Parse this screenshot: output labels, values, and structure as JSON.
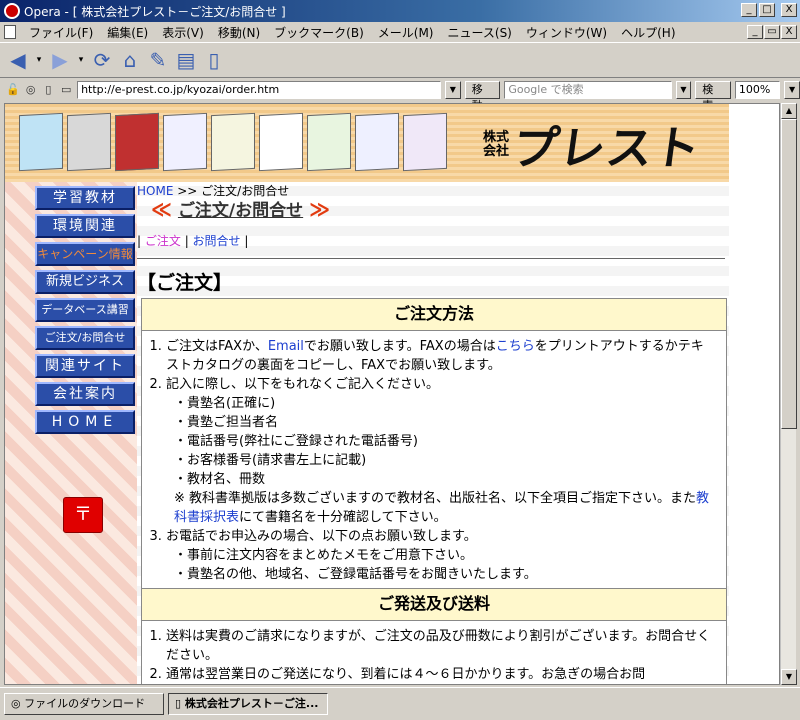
{
  "window": {
    "title": "Opera - [ 株式会社プレスト－ご注文/お問合せ ]",
    "buttons": {
      "min": "_",
      "max": "□",
      "close": "X",
      "restore": "▭"
    }
  },
  "menu": [
    "ファイル(F)",
    "編集(E)",
    "表示(V)",
    "移動(N)",
    "ブックマーク(B)",
    "メール(M)",
    "ニュース(S)",
    "ウィンドウ(W)",
    "ヘルプ(H)"
  ],
  "address": {
    "url": "http://e-prest.co.jp/kyozai/order.htm",
    "go_label": "移動",
    "search_placeholder": "Google で検索",
    "search_button": "検索",
    "zoom": "100%"
  },
  "site": {
    "logo_kabu": "株式\n会社",
    "logo_name": "プレスト",
    "sidenav": [
      "学習教材",
      "環境関連",
      "キャンペーン情報",
      "新規ビジネス",
      "データベース講習",
      "ご注文/お問合せ",
      "関連サイト",
      "会社案内",
      "HOME"
    ],
    "breadcrumb_home": "HOME",
    "breadcrumb_rest": " >> ご注文/お問合せ",
    "heading": "ご注文/お問合せ",
    "subnav": [
      "ご注文",
      "お問合せ"
    ],
    "section_title": "【ご注文】",
    "panel1": {
      "title": "ご注文方法",
      "item1_a": "ご注文はFAXか、",
      "item1_email": "Email",
      "item1_b": "でお願い致します。FAXの場合は",
      "item1_link": "こちら",
      "item1_c": "をプリントアウトするかテキストカタログの裏面をコピーし、FAXでお願い致します。",
      "item2": "記入に際し、以下をもれなくご記入ください。",
      "fields": [
        "貴塾名(正確に)",
        "貴塾ご担当者名",
        "電話番号(弊社にご登録された電話番号)",
        "お客様番号(請求書左上に記載)",
        "教材名、冊数"
      ],
      "note_a": "※ 教科書準拠版は多数ございますので教材名、出版社名、以下全項目ご指定下さい。また",
      "note_link": "教科書採択表",
      "note_b": "にて書籍名を十分確認して下さい。",
      "item3": "お電話でお申込みの場合、以下の点お願い致します。",
      "phone_points": [
        "事前に注文内容をまとめたメモをご用意下さい。",
        "貴塾名の他、地域名、ご登録電話番号をお聞きいたします。"
      ]
    },
    "panel2": {
      "title": "ご発送及び送料",
      "item1": "送料は実費のご請求になりますが、ご注文の品及び冊数により割引がございます。お問合せください。",
      "item2": "通常は翌営業日のご発送になり、到着には４～６日かかります。お急ぎの場合お問"
    }
  },
  "taskbar": {
    "items": [
      "ファイルのダウンロード",
      "株式会社プレスト－ご注..."
    ]
  }
}
